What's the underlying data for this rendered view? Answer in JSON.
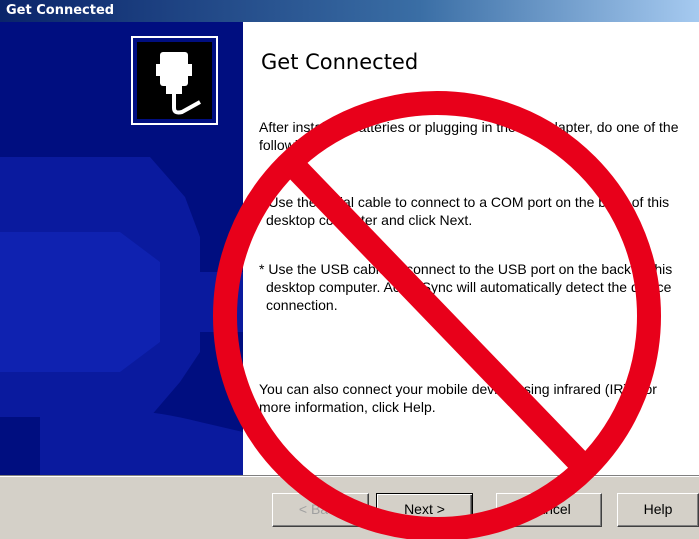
{
  "window": {
    "title": "Get Connected"
  },
  "content": {
    "heading": "Get Connected",
    "intro": "After installing batteries or plugging in the AC adapter, do one of the following:",
    "bullet_serial": "* Use the serial cable to connect to a COM port on the back of this desktop computer and click Next.",
    "bullet_usb": "* Use the USB cable to connect to the USB port on the back of this desktop computer.   ActiveSync will automatically detect the device connection.",
    "infrared": "You can also connect your mobile device using infrared (IR). For more information, click Help."
  },
  "buttons": {
    "back_label": "< Back",
    "next_label": "Next >",
    "cancel_label": "Cancel",
    "help_label": "Help"
  },
  "icons": {
    "connector": "serial-connector-icon",
    "prohibited": "prohibited-sign"
  },
  "colors": {
    "title_bar": "#0a246a",
    "side_panel": "#000e80",
    "prohibited_red": "#e8001a"
  }
}
